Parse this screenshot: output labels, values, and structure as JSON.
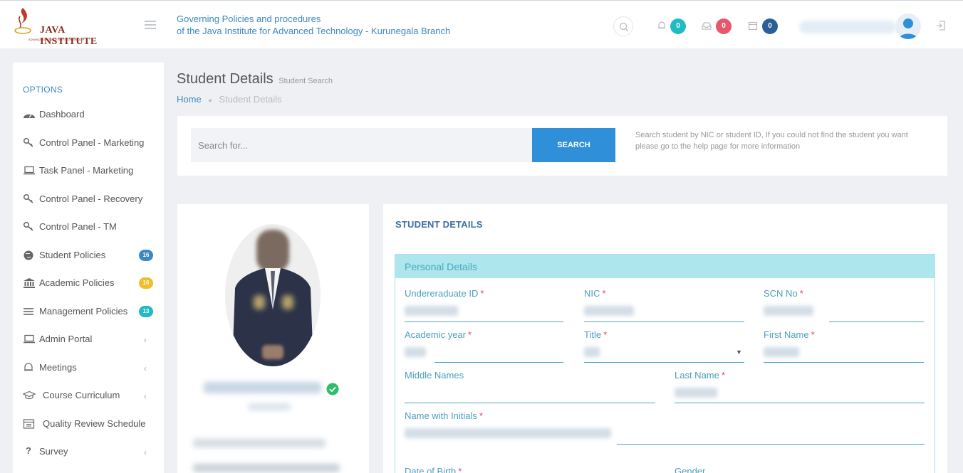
{
  "header": {
    "logo_text": "JAVA INSTITUTE",
    "logo_subtitle": "ADVANCING YOU TO THE TECHNOLOGY",
    "gov_line1": "Governing Policies and procedures",
    "gov_line2": "of the Java Institute for Advanced Technology - Kurunegala Branch",
    "notifications_count": "0",
    "messages_count": "0",
    "calendar_count": "0"
  },
  "colors": {
    "accent": "#2f8fd8",
    "teal": "#21bbc3",
    "red": "#e8566b",
    "navy": "#2a6097",
    "yellow": "#f2bc2a"
  },
  "sidebar": {
    "title": "OPTIONS",
    "items": [
      {
        "label": "Dashboard",
        "icon": "dashboard-icon"
      },
      {
        "label": "Control Panel - Marketing",
        "icon": "key-icon"
      },
      {
        "label": "Task Panel - Marketing",
        "icon": "laptop-icon"
      },
      {
        "label": "Control Panel - Recovery",
        "icon": "key-icon"
      },
      {
        "label": "Control Panel - TM",
        "icon": "key-icon"
      },
      {
        "label": "Student Policies",
        "icon": "globe-icon",
        "badge": "16"
      },
      {
        "label": "Academic Policies",
        "icon": "bank-icon",
        "badge": "16"
      },
      {
        "label": "Management Policies",
        "icon": "list-icon",
        "badge": "13"
      },
      {
        "label": "Admin Portal",
        "icon": "laptop-icon"
      },
      {
        "label": "Meetings",
        "icon": "bell-icon"
      },
      {
        "label": "Course Curriculum",
        "icon": "graduation-icon"
      },
      {
        "label": "Quality Review Schedule",
        "icon": "calendar-icon"
      },
      {
        "label": "Survey",
        "icon": "question-icon"
      }
    ]
  },
  "page": {
    "title": "Student Details",
    "subtitle": "Student Search",
    "breadcrumb_home": "Home",
    "breadcrumb_current": "Student Details"
  },
  "search": {
    "placeholder": "Search for...",
    "button_label": "SEARCH",
    "help_text": "Search student by NIC or student ID, If you could not find the student you want please go to the help page for more information"
  },
  "details": {
    "title": "STUDENT DETAILS",
    "panel_title": "Personal Details",
    "fields": {
      "undergraduate_id": "Undereraduate ID",
      "nic": "NIC",
      "scn_no": "SCN No",
      "academic_year": "Academic year",
      "title": "Title",
      "first_name": "First Name",
      "middle_names": "Middle Names",
      "last_name": "Last Name",
      "name_with_initials": "Name with Initials",
      "date_of_birth": "Date of Birth",
      "gender": "Gender"
    }
  }
}
